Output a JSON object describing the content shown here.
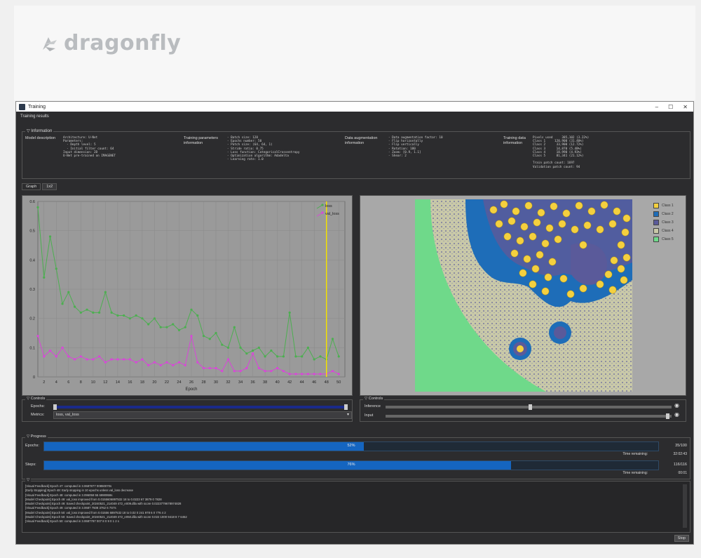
{
  "brand": {
    "name": "dragonfly"
  },
  "window": {
    "title": "Training",
    "subtitle": "Training results",
    "controls": [
      "–",
      "☐",
      "✕"
    ]
  },
  "info": {
    "header": "Information",
    "model_label": "Model description",
    "model_text": "Architecture: U-Net\nParameters:\n  - Depth level: 5\n  - Initial filter count: 64\nInput dimension: 2D\nU-Net pre-trained on IMAGENET",
    "train_label": "Training parameters\ninformation",
    "train_text": "- Batch size: 128\n- Epochs number: 50\n- Patch size: (64, 64, 1)\n- Stride ratio: 0.75\n- Loss function: CategoricalCrossentropy\n- Optimization algorithm: Adadelta\n- Learning rate: 1.0",
    "aug_label": "Data augmentation\ninformation",
    "aug_text": "- Data augmentation factor: 10\n- Flip horizontally\n- Flip vertically\n- Rotation: 180\n- Zoom: [0.9, 1.1]\n- Shear: 2",
    "data_label": "Training data\ninformation",
    "data_text": "Pixels used     385,102 (3.22%)\nClass 1     120,900 (31.40%)\nClass 2      33,900 (12.72%)\nClass 3      14,870 (5.48%)\nClass 4      18,990 (4.93%)\nClass 5      81,341 (21.12%)\n\nTrain patch count: 1697\nValidation patch count: 94"
  },
  "tabs": [
    "Graph",
    "1x2"
  ],
  "chart_data": {
    "type": "line",
    "xlabel": "Epoch",
    "ylabel": "",
    "xlim": [
      1,
      51
    ],
    "ylim": [
      0,
      0.6
    ],
    "xticks": [
      2,
      4,
      6,
      8,
      10,
      12,
      14,
      16,
      18,
      20,
      22,
      24,
      26,
      28,
      30,
      32,
      34,
      36,
      38,
      40,
      42,
      44,
      46,
      48,
      50
    ],
    "yticks": [
      0,
      0.1,
      0.2,
      0.3,
      0.4,
      0.5,
      0.6
    ],
    "ytick_labels": [
      "0",
      "0.1",
      "0.2",
      "0.3",
      "0.4",
      "0.5",
      "0.6"
    ],
    "x": [
      1,
      2,
      3,
      4,
      5,
      6,
      7,
      8,
      9,
      10,
      11,
      12,
      13,
      14,
      15,
      16,
      17,
      18,
      19,
      20,
      21,
      22,
      23,
      24,
      25,
      26,
      27,
      28,
      29,
      30,
      31,
      32,
      33,
      34,
      35,
      36,
      37,
      38,
      39,
      40,
      41,
      42,
      43,
      44,
      45,
      46,
      47,
      48,
      49,
      50
    ],
    "series": [
      {
        "name": "loss",
        "color": "#4caf50",
        "values": [
          0.58,
          0.34,
          0.48,
          0.37,
          0.25,
          0.29,
          0.24,
          0.22,
          0.23,
          0.22,
          0.22,
          0.29,
          0.22,
          0.21,
          0.21,
          0.2,
          0.21,
          0.2,
          0.18,
          0.2,
          0.17,
          0.17,
          0.18,
          0.16,
          0.17,
          0.23,
          0.21,
          0.14,
          0.13,
          0.15,
          0.11,
          0.1,
          0.17,
          0.1,
          0.08,
          0.09,
          0.1,
          0.07,
          0.09,
          0.07,
          0.07,
          0.22,
          0.07,
          0.07,
          0.1,
          0.06,
          0.07,
          0.06,
          0.13,
          0.07
        ]
      },
      {
        "name": "val_loss",
        "color": "#d946d9",
        "values": [
          0.14,
          0.07,
          0.09,
          0.07,
          0.1,
          0.07,
          0.06,
          0.07,
          0.06,
          0.06,
          0.07,
          0.05,
          0.06,
          0.06,
          0.06,
          0.06,
          0.05,
          0.06,
          0.04,
          0.05,
          0.04,
          0.05,
          0.04,
          0.05,
          0.04,
          0.14,
          0.05,
          0.03,
          0.03,
          0.03,
          0.02,
          0.06,
          0.02,
          0.02,
          0.03,
          0.08,
          0.03,
          0.02,
          0.02,
          0.03,
          0.02,
          0.01,
          0.01,
          0.01,
          0.01,
          0.01,
          0.01,
          0.01,
          0.02,
          0.01
        ]
      }
    ],
    "marker_epoch": 48
  },
  "image_legend": [
    {
      "label": "Class 1",
      "color": "#f4d03f"
    },
    {
      "label": "Class 2",
      "color": "#1e6db8"
    },
    {
      "label": "Class 3",
      "color": "#5a5a9a"
    },
    {
      "label": "Class 4",
      "color": "#c9c9a8"
    },
    {
      "label": "Class 5",
      "color": "#6fd98a"
    }
  ],
  "chart_controls": {
    "header": "Controls",
    "epochs_label": "Epochs:",
    "metrics_label": "Metrics:",
    "metrics_value": "loss, val_loss"
  },
  "image_controls": {
    "header": "Controls",
    "inference_label": "Inference",
    "input_label": "Input"
  },
  "progress": {
    "header": "Progress",
    "epochs_label": "Epochs:",
    "epochs_pct": 52,
    "epochs_text": "52%",
    "epochs_count": "35/100",
    "epochs_time_label": "Time remaining:",
    "epochs_time": "32:02:43",
    "steps_label": "Steps:",
    "steps_pct": 76,
    "steps_text": "76%",
    "steps_count": "116/116",
    "steps_time_label": "Time remaining:",
    "steps_time": "00:01"
  },
  "log": {
    "lines": [
      "[Visual Feedback] Epoch 47: computed in 3.0687877 00850070s",
      "[Early Stopping] Epoch 48: Early stopping in 10 epochs unless val_loss decrease",
      "[Visual Feedback] Epoch 48: computed in 3.096058 55 6990959s",
      "[Model Checkpoint] Epoch 49: val_loss improved from 0.0155606897532 18 to 0.0223 67 3879 0 7828",
      "[Model Checkpoint] Epoch 49: Saved checkpoint_20240521_214049 472_e009.dlla with score 0.0223779678974828",
      "[Visual Feedback] Epoch 49: computed in 3.0687 7508 3762 6 7S7s",
      "[Model Checkpoint] Epoch 50: val_loss improved from 0.01556 6897532 18 to 0.02 0 241 978 6 0 776 4 2",
      "[Model Checkpoint] Epoch 50: Saved checkpoint_20240521_214049 472_e050.dlla with score 0.022 1000 9418 8 7 6452",
      "[Visual Feedback] Epoch 50: computed in 3.0687787 007 8 0 9 0 1 2 s"
    ]
  },
  "stop_label": "Stop"
}
